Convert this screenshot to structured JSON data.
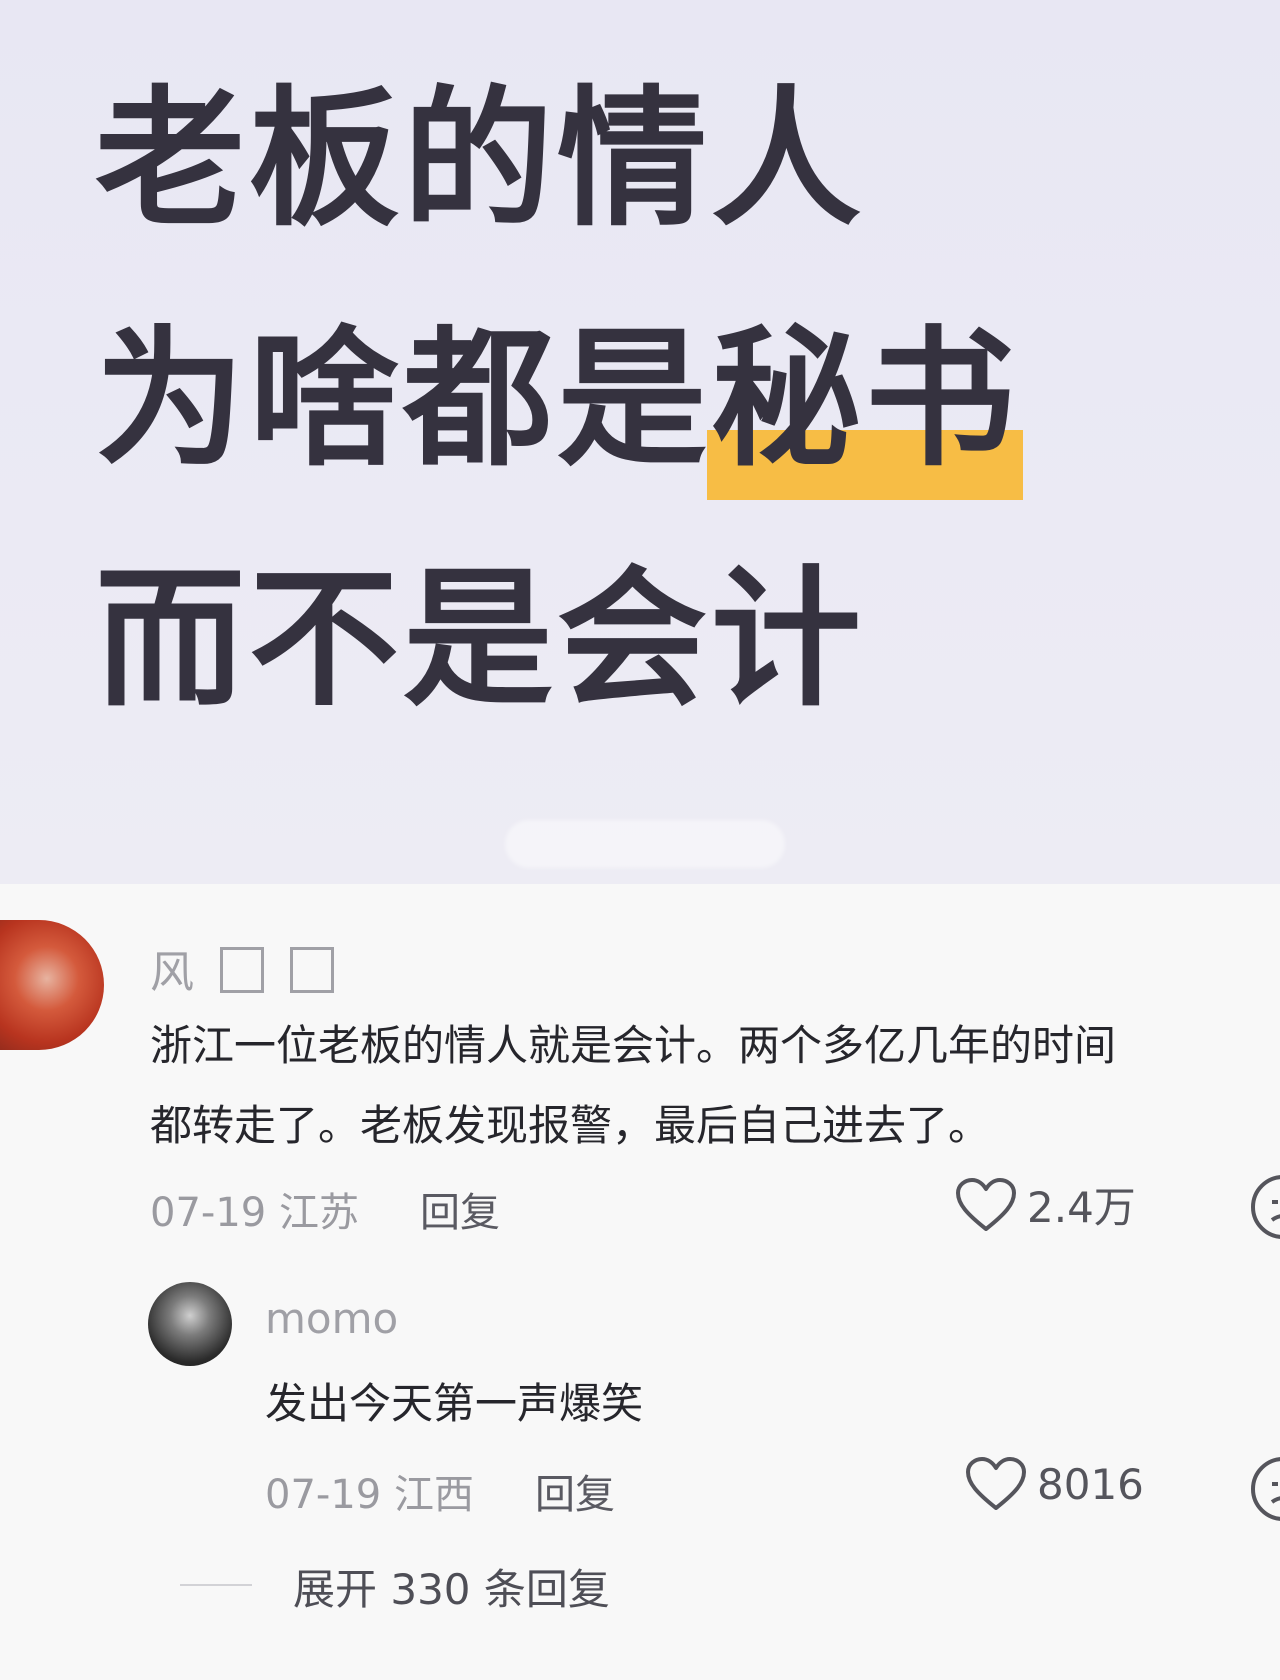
{
  "headline": {
    "line1": "老板的情人",
    "line2_prefix": "为啥都是",
    "line2_highlight": "秘书",
    "line3": "而不是会计",
    "highlight_color": "#f7bd45"
  },
  "comments": [
    {
      "username": "风",
      "text_line1": "浙江一位老板的情人就是会计。两个多亿几年的时间",
      "text_line2": "都转走了。老板发现报警，最后自己进去了。",
      "date_location": "07-19 江苏",
      "reply_label": "回复",
      "likes": "2.4万",
      "avatar_icon": "avatar-icon"
    },
    {
      "username": "momo",
      "text": "发出今天第一声爆笑",
      "date_location": "07-19 江西",
      "reply_label": "回复",
      "likes": "8016",
      "avatar_icon": "avatar-icon"
    }
  ],
  "expand_replies": "展开 330 条回复",
  "icons": {
    "like": "heart-icon",
    "dislike": "face-icon"
  }
}
